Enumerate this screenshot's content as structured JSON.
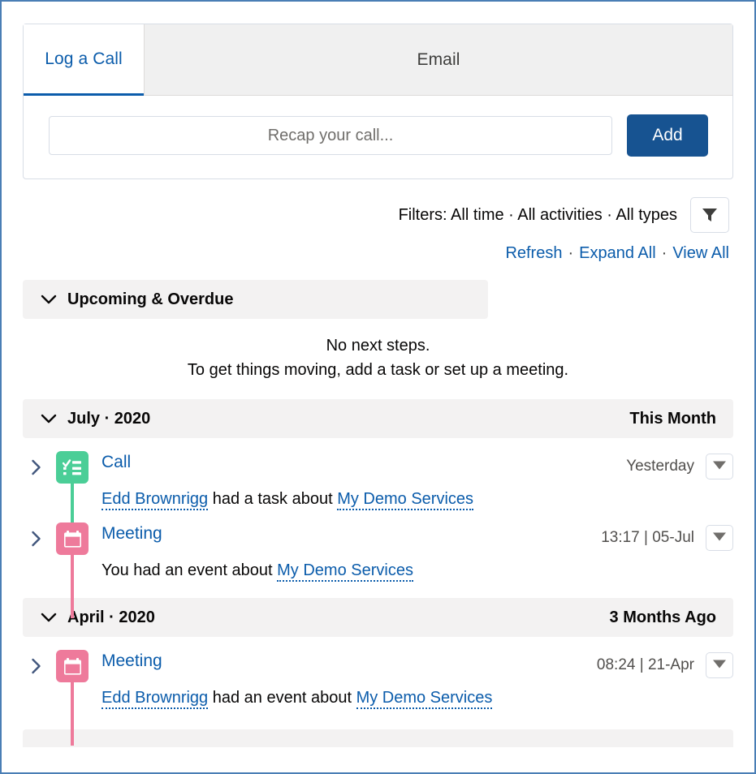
{
  "publisher": {
    "tabs": [
      {
        "label": "Log a Call",
        "active": true
      },
      {
        "label": "Email",
        "active": false
      }
    ],
    "input_placeholder": "Recap your call...",
    "input_value": "",
    "add_label": "Add"
  },
  "filters": {
    "summary": "Filters: All time · All activities · All types",
    "filter_icon": "filter-funnel-icon"
  },
  "actions": {
    "refresh": "Refresh",
    "expand_all": "Expand All",
    "view_all": "View All",
    "separator": "·"
  },
  "upcoming": {
    "title": "Upcoming & Overdue",
    "empty_line1": "No next steps.",
    "empty_line2": "To get things moving, add a task or set up a meeting."
  },
  "sections": [
    {
      "title": "July · 2020",
      "relative": "This Month",
      "items": [
        {
          "type": "Call",
          "icon": "task-checklist-icon",
          "icon_kind": "task",
          "date": "Yesterday",
          "desc_prefix": "",
          "actor": "Edd Brownrigg",
          "desc_middle": " had a task about ",
          "subject": "My Demo Services",
          "desc_suffix": ""
        },
        {
          "type": "Meeting",
          "icon": "calendar-event-icon",
          "icon_kind": "event",
          "date": "13:17 | 05-Jul",
          "desc_prefix": "You had an event about ",
          "actor": "",
          "desc_middle": "",
          "subject": "My Demo Services",
          "desc_suffix": ""
        }
      ]
    },
    {
      "title": "April · 2020",
      "relative": "3 Months Ago",
      "items": [
        {
          "type": "Meeting",
          "icon": "calendar-event-icon",
          "icon_kind": "event",
          "date": "08:24 | 21-Apr",
          "desc_prefix": "",
          "actor": "Edd Brownrigg",
          "desc_middle": " had an event about ",
          "subject": "My Demo Services",
          "desc_suffix": ""
        }
      ]
    }
  ],
  "colors": {
    "link": "#0b5cab",
    "primary_button": "#175391",
    "task_green": "#4bce97",
    "event_pink": "#ee7a9b",
    "section_bg": "#f3f2f2",
    "frame_border": "#4a7eb5"
  }
}
